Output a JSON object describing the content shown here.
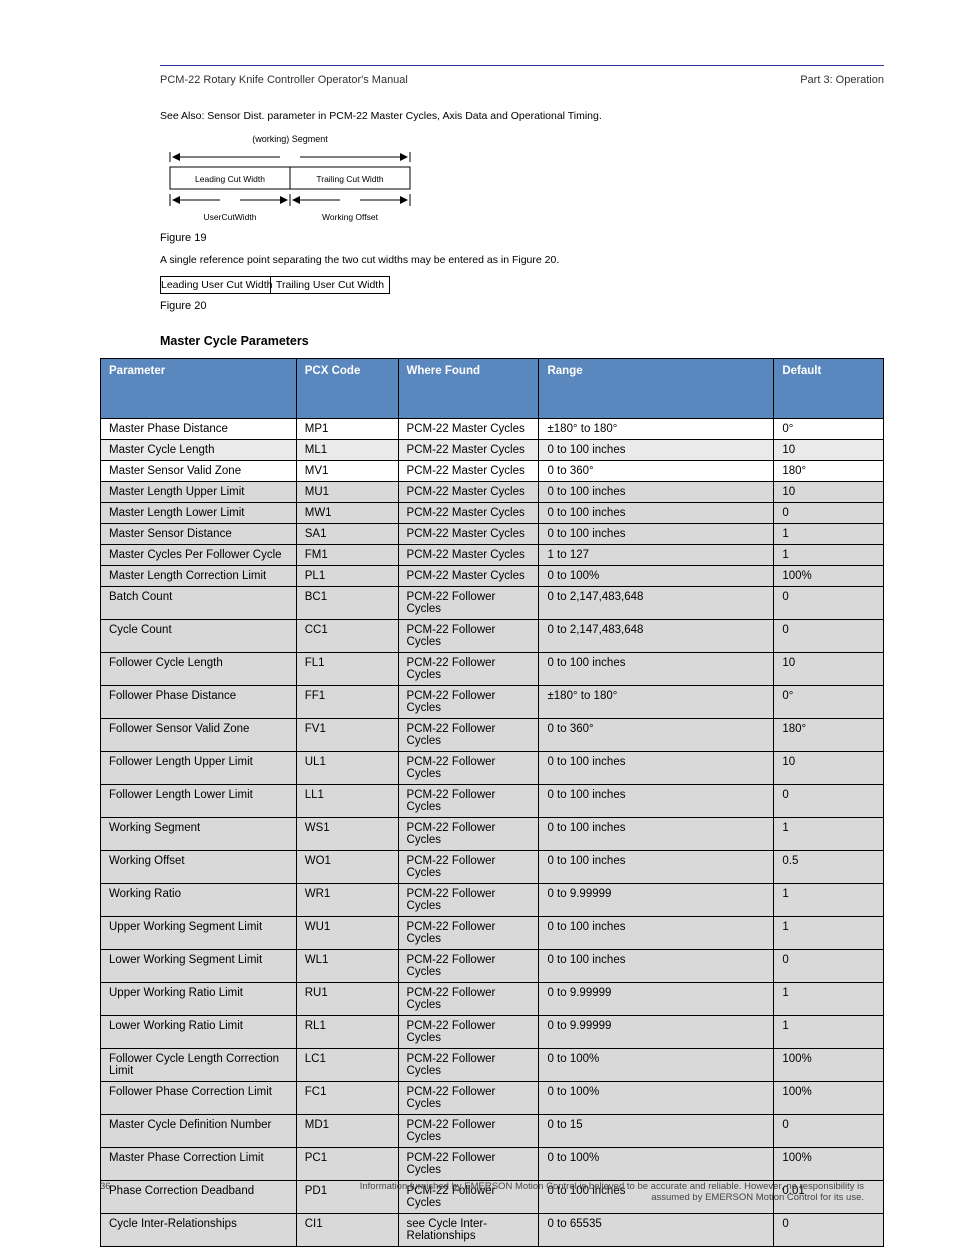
{
  "header": {
    "manual": "PCM-22 Rotary Knife Controller Operator's Manual",
    "part": "Part 3: Operation"
  },
  "topic_line": "See Also: Sensor Dist. parameter in PCM-22 Master Cycles, Axis Data and Operational Timing.",
  "figures": {
    "fig19": {
      "label": "Figure 19",
      "top_label": "(working) Segment",
      "bottom_left": "UserCutWidth",
      "bottom_right": "Working Offset",
      "left": "Leading Cut Width",
      "right": "Trailing Cut Width"
    },
    "fig20": {
      "label": "Figure 20",
      "caption": "A single reference point separating the two cut widths may be entered as in Figure 20.",
      "left": "Leading User Cut Width",
      "right": "Trailing User Cut Width"
    }
  },
  "section": "Master Cycle Parameters",
  "table": {
    "headers": [
      "Parameter",
      "PCX Code",
      "Where Found",
      "Range",
      "Default"
    ],
    "rows": [
      {
        "cls": "b",
        "c": [
          "Master Phase Distance",
          "MP1",
          "PCM-22 Master Cycles",
          "±180° to 180°",
          "0°"
        ]
      },
      {
        "cls": "g",
        "c": [
          "Master Cycle Length",
          "ML1",
          "PCM-22 Master Cycles",
          "0 to 100 inches",
          "10"
        ]
      },
      {
        "cls": "b",
        "c": [
          "Master Sensor Valid Zone",
          "MV1",
          "PCM-22 Master Cycles",
          "0 to 360°",
          "180°"
        ]
      },
      {
        "cls": "d",
        "c": [
          "Master Length Upper Limit",
          "MU1",
          "PCM-22 Master Cycles",
          "0 to 100 inches",
          "10"
        ]
      },
      {
        "cls": "d",
        "c": [
          "Master Length Lower Limit",
          "MW1",
          "PCM-22 Master Cycles",
          "0 to 100 inches",
          "0"
        ]
      },
      {
        "cls": "d",
        "c": [
          "Master Sensor Distance",
          "SA1",
          "PCM-22 Master Cycles",
          "0 to 100 inches",
          "1"
        ]
      },
      {
        "cls": "d",
        "c": [
          "Master Cycles Per Follower Cycle",
          "FM1",
          "PCM-22 Master Cycles",
          "1 to 127",
          "1"
        ]
      },
      {
        "cls": "d",
        "c": [
          "Master Length Correction Limit",
          "PL1",
          "PCM-22 Master Cycles",
          "0 to 100%",
          "100%"
        ]
      },
      {
        "cls": "d",
        "c": [
          "Batch Count",
          "BC1",
          "PCM-22 Follower Cycles",
          "0 to 2,147,483,648",
          "0"
        ]
      },
      {
        "cls": "d",
        "c": [
          "Cycle Count",
          "CC1",
          "PCM-22 Follower Cycles",
          "0 to 2,147,483,648",
          "0"
        ]
      },
      {
        "cls": "d",
        "c": [
          "Follower Cycle Length",
          "FL1",
          "PCM-22 Follower Cycles",
          "0 to 100 inches",
          "10"
        ]
      },
      {
        "cls": "d",
        "c": [
          "Follower Phase Distance",
          "FF1",
          "PCM-22 Follower Cycles",
          "±180° to 180°",
          "0°"
        ]
      },
      {
        "cls": "d",
        "c": [
          "Follower Sensor Valid Zone",
          "FV1",
          "PCM-22 Follower Cycles",
          "0 to 360°",
          "180°"
        ]
      },
      {
        "cls": "d",
        "c": [
          "Follower Length Upper Limit",
          "UL1",
          "PCM-22 Follower Cycles",
          "0 to 100 inches",
          "10"
        ]
      },
      {
        "cls": "d",
        "c": [
          "Follower Length Lower Limit",
          "LL1",
          "PCM-22 Follower Cycles",
          "0 to 100 inches",
          "0"
        ]
      },
      {
        "cls": "d",
        "c": [
          "Working Segment",
          "WS1",
          "PCM-22 Follower Cycles",
          "0 to 100 inches",
          "1"
        ]
      },
      {
        "cls": "d",
        "c": [
          "Working Offset",
          "WO1",
          "PCM-22 Follower Cycles",
          "0 to 100 inches",
          "0.5"
        ]
      },
      {
        "cls": "d",
        "c": [
          "Working Ratio",
          "WR1",
          "PCM-22 Follower Cycles",
          "0 to 9.99999",
          "1"
        ]
      },
      {
        "cls": "d",
        "c": [
          "Upper Working Segment Limit",
          "WU1",
          "PCM-22 Follower Cycles",
          "0 to 100 inches",
          "1"
        ]
      },
      {
        "cls": "d",
        "c": [
          "Lower Working Segment Limit",
          "WL1",
          "PCM-22 Follower Cycles",
          "0 to 100 inches",
          "0"
        ]
      },
      {
        "cls": "d",
        "c": [
          "Upper Working Ratio Limit",
          "RU1",
          "PCM-22 Follower Cycles",
          "0 to 9.99999",
          "1"
        ]
      },
      {
        "cls": "d",
        "c": [
          "Lower Working Ratio Limit",
          "RL1",
          "PCM-22 Follower Cycles",
          "0 to 9.99999",
          "1"
        ]
      },
      {
        "cls": "d",
        "c": [
          "Follower Cycle Length Correction Limit",
          "LC1",
          "PCM-22 Follower Cycles",
          "0 to 100%",
          "100%"
        ]
      },
      {
        "cls": "d",
        "c": [
          "Follower Phase Correction Limit",
          "FC1",
          "PCM-22 Follower Cycles",
          "0 to 100%",
          "100%"
        ]
      },
      {
        "cls": "d",
        "c": [
          "Master Cycle Definition Number",
          "MD1",
          "PCM-22 Follower Cycles",
          "0 to 15",
          "0"
        ]
      },
      {
        "cls": "d",
        "c": [
          "Master Phase Correction Limit",
          "PC1",
          "PCM-22 Follower Cycles",
          "0 to 100%",
          "100%"
        ]
      },
      {
        "cls": "d",
        "c": [
          "Phase Correction Deadband",
          "PD1",
          "PCM-22 Follower Cycles",
          "0 to 100 inches",
          "0.01"
        ]
      },
      {
        "cls": "d",
        "c": [
          "Cycle Inter-Relationships",
          "CI1",
          "see Cycle Inter-Relationships",
          "0 to 65535",
          "0"
        ]
      }
    ]
  },
  "footer": {
    "page": "36",
    "right": "Information furnished by EMERSON Motion Control is believed to be accurate and reliable. However, no responsibility is assumed by EMERSON Motion Control for its use."
  }
}
